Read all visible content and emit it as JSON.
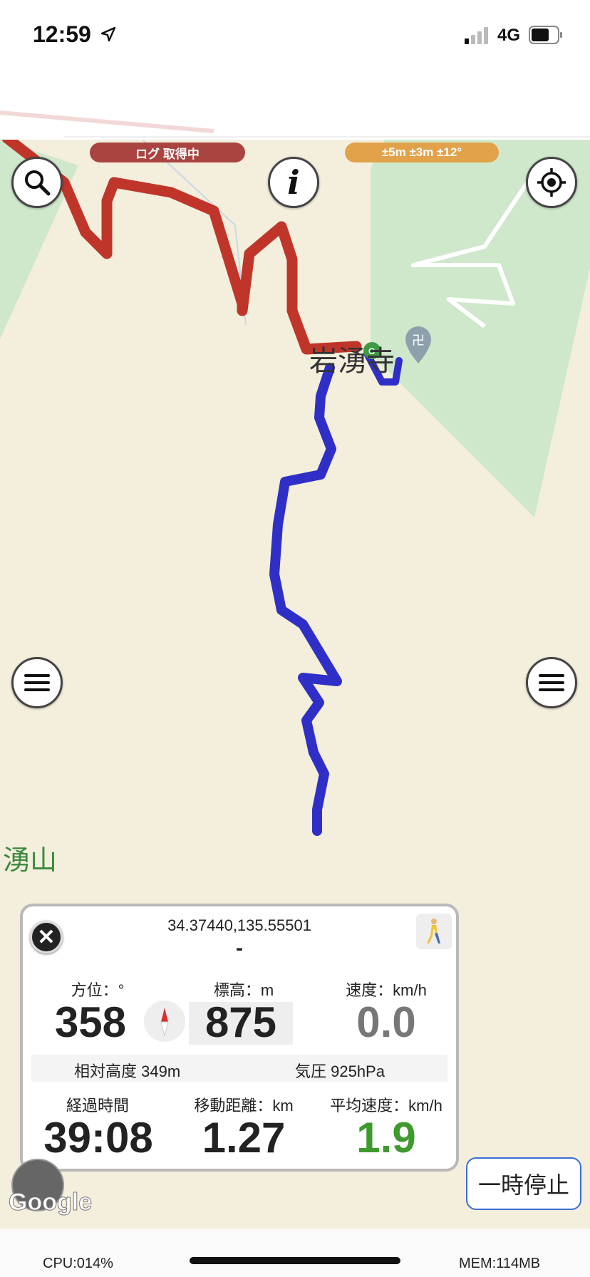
{
  "status_bar": {
    "time": "12:59",
    "network": "4G"
  },
  "map": {
    "log_status": "ログ 取得中",
    "accuracy": "±5m ±3m ±12°",
    "temple_label": "岩湧寺",
    "mountain_label": "湧山",
    "google_logo": "Google",
    "buttons": {
      "search": "search-icon",
      "info": "i",
      "locate": "crosshair-icon",
      "menu": "hamburger-icon"
    }
  },
  "panel": {
    "coordinates": "34.37440,135.55501",
    "address": "-",
    "heading_label": "方位：°",
    "heading_value": "358",
    "elevation_label": "標高：m",
    "elevation_value": "875",
    "speed_label": "速度：km/h",
    "speed_value": "0.0",
    "relative_altitude": "相対高度 349m",
    "pressure": "気圧 925hPa",
    "elapsed_label": "経過時間",
    "elapsed_value": "39:08",
    "distance_label": "移動距離：km",
    "distance_value": "1.27",
    "avg_speed_label": "平均速度：km/h",
    "avg_speed_value": "1.9",
    "colors": {
      "speed": "#777777",
      "avg_speed": "#3f9a2e"
    }
  },
  "controls": {
    "pause_label": "一時停止"
  },
  "footer": {
    "cpu": "CPU:014%",
    "mem": "MEM:114MB"
  }
}
